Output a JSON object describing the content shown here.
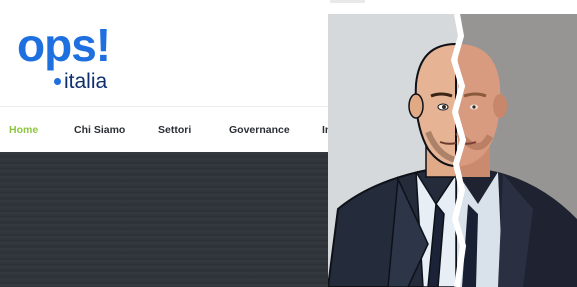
{
  "logo": {
    "main": "ops!",
    "sub": "italia"
  },
  "nav": {
    "items": [
      {
        "label": "Home",
        "active": true
      },
      {
        "label": "Chi Siamo",
        "active": false
      },
      {
        "label": "Settori",
        "active": false
      },
      {
        "label": "Governance",
        "active": false
      },
      {
        "label": "In",
        "active": false
      }
    ]
  },
  "colors": {
    "brand_blue": "#1e6fe0",
    "brand_dark": "#0e2f6e",
    "nav_active": "#8cc63f",
    "hero_bg": "#31363c"
  },
  "image": {
    "subject": "person-portrait-split-cartoon-photo"
  }
}
